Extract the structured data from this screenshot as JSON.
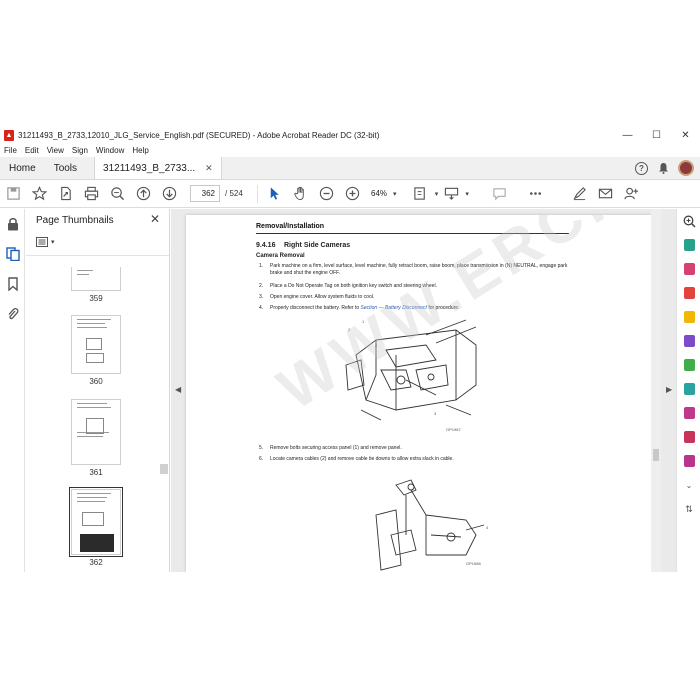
{
  "window": {
    "title": "31211493_B_2733,12010_JLG_Service_English.pdf (SECURED) - Adobe Acrobat Reader DC (32-bit)",
    "minimize": "—",
    "maximize": "☐",
    "close": "✕"
  },
  "menu": [
    "File",
    "Edit",
    "View",
    "Sign",
    "Window",
    "Help"
  ],
  "tabs": {
    "home": "Home",
    "tools": "Tools",
    "doc": "31211493_B_2733...",
    "doc_close": "✕"
  },
  "toolbar": {
    "current_page": "362",
    "total_pages": "/ 524",
    "zoom": "64%"
  },
  "thumbnails": {
    "title": "Page Thumbnails",
    "close": "✕",
    "pages": [
      "359",
      "360",
      "361",
      "362"
    ],
    "selected": "362"
  },
  "document": {
    "section_title": "Removal/Installation",
    "section_number": "9.4.16",
    "heading": "Right Side Cameras",
    "subheading": "Camera Removal",
    "steps": [
      {
        "n": "1.",
        "text": "Park machine on a firm, level surface, level machine, fully retract boom, raise boom, place transmission in (N) NEUTRAL, engage park brake and shut the engine OFF."
      },
      {
        "n": "2.",
        "text": "Place a Do Not Operate Tag on both ignition key switch and steering wheel."
      },
      {
        "n": "3.",
        "text": "Open engine cover. Allow system fluids to cool."
      },
      {
        "n": "4.",
        "text": "Properly disconnect the battery. Refer to",
        "link": "Section — Battery Disconnect",
        "after": "for procedure."
      },
      {
        "n": "5.",
        "text": "Remove bolts securing access panel (1) and remove panel."
      },
      {
        "n": "6.",
        "text": "Locate camera cables (2) and remove cable tie downs to allow extra slack in cable."
      }
    ],
    "fig_labels": [
      "1",
      "2",
      "3",
      "4"
    ],
    "fig_ids": [
      "OP1987",
      "OP1988"
    ],
    "watermark": "WWW.ERCP..COM"
  },
  "colors": {
    "acrobat_red": "#d9241c",
    "link_blue": "#2a5db0"
  }
}
